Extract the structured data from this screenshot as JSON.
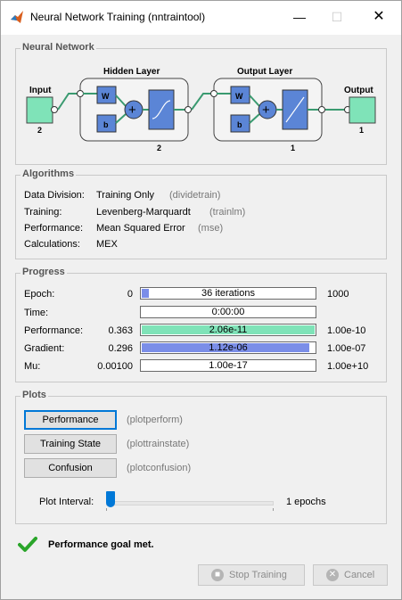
{
  "window": {
    "title": "Neural Network Training (nntraintool)"
  },
  "network": {
    "group_title": "Neural Network",
    "input_label": "Input",
    "input_size": "2",
    "hidden_label": "Hidden Layer",
    "hidden_size": "2",
    "output_layer_label": "Output Layer",
    "output_layer_size": "1",
    "output_label": "Output",
    "output_size": "1",
    "w_label": "W",
    "b_label": "b"
  },
  "algorithms": {
    "group_title": "Algorithms",
    "rows": [
      {
        "label": "Data Division:",
        "value": "Training Only",
        "fn": "(dividetrain)"
      },
      {
        "label": "Training:",
        "value": "Levenberg-Marquardt",
        "fn": "(trainlm)"
      },
      {
        "label": "Performance:",
        "value": "Mean Squared Error",
        "fn": "(mse)"
      },
      {
        "label": "Calculations:",
        "value": "MEX",
        "fn": ""
      }
    ]
  },
  "progress": {
    "group_title": "Progress",
    "rows": [
      {
        "label": "Epoch:",
        "start": "0",
        "bar": "36 iterations",
        "end": "1000",
        "fill": 0.04,
        "color": "#7b8ee8"
      },
      {
        "label": "Time:",
        "start": "",
        "bar": "0:00:00",
        "end": "",
        "fill": 0,
        "color": "#7b8ee8"
      },
      {
        "label": "Performance:",
        "start": "0.363",
        "bar": "2.06e-11",
        "end": "1.00e-10",
        "fill": 1.0,
        "color": "#7fe3b8"
      },
      {
        "label": "Gradient:",
        "start": "0.296",
        "bar": "1.12e-06",
        "end": "1.00e-07",
        "fill": 0.97,
        "color": "#7b8ee8"
      },
      {
        "label": "Mu:",
        "start": "0.00100",
        "bar": "1.00e-17",
        "end": "1.00e+10",
        "fill": 0,
        "color": "#7b8ee8"
      }
    ]
  },
  "plots": {
    "group_title": "Plots",
    "buttons": [
      {
        "label": "Performance",
        "fn": "(plotperform)"
      },
      {
        "label": "Training State",
        "fn": "(plottrainstate)"
      },
      {
        "label": "Confusion",
        "fn": "(plotconfusion)"
      }
    ],
    "interval_label": "Plot Interval:",
    "interval_value": "1 epochs",
    "interval_fraction": 0.0
  },
  "status": {
    "text": "Performance goal met."
  },
  "footer": {
    "stop_label": "Stop Training",
    "cancel_label": "Cancel"
  },
  "colors": {
    "block_green": "#7fe3b8",
    "block_blue": "#5b85d6",
    "accent": "#0078d7"
  }
}
